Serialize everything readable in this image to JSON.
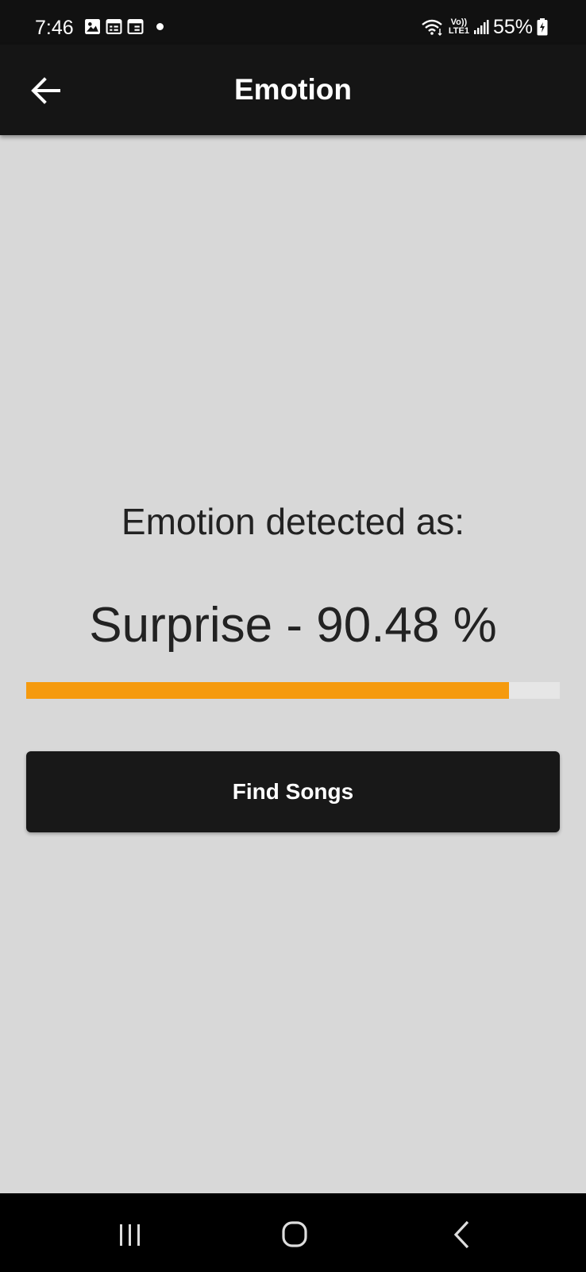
{
  "status_bar": {
    "time": "7:46",
    "icons_left": [
      "gallery-icon",
      "calendar-icon",
      "calendar-icon"
    ],
    "signal_top": "Vo))",
    "signal_bottom": "LTE1",
    "battery_percent": "55%"
  },
  "app_bar": {
    "title": "Emotion",
    "back_icon": "arrow-left-icon"
  },
  "content": {
    "detected_label": "Emotion detected as:",
    "result": "Surprise - 90.48 %",
    "confidence_fraction": 0.9048,
    "progress_color": "#f59a0e"
  },
  "actions": {
    "find_songs_label": "Find Songs"
  },
  "nav_bar": {
    "recents_icon": "recents-icon",
    "home_icon": "home-icon",
    "back_icon": "chevron-left-icon"
  }
}
